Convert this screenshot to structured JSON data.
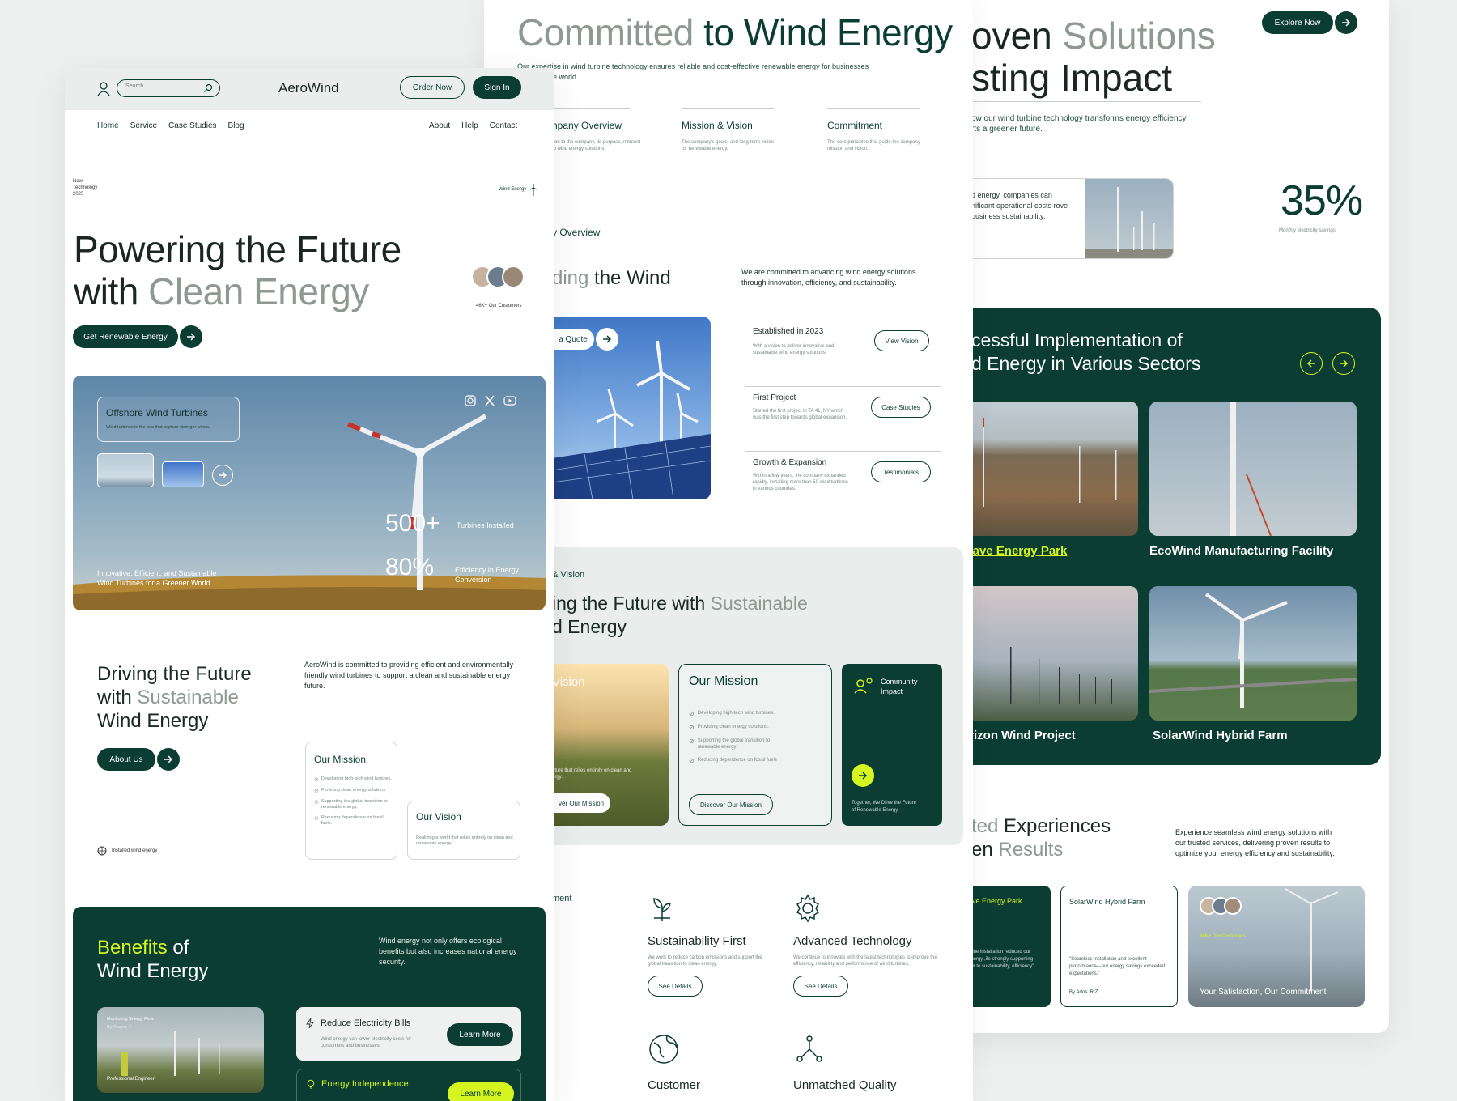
{
  "colors": {
    "primary": "#0b3d33",
    "accent": "#d4f51f",
    "bg": "#eef0ef"
  },
  "left": {
    "nav": {
      "search_placeholder": "Search",
      "logo": "AeroWind",
      "order": "Order Now",
      "signin": "Sign In",
      "links": [
        "Home",
        "Service",
        "Case Studies",
        "Blog"
      ],
      "links_right": [
        "About",
        "Help",
        "Contact"
      ]
    },
    "hero": {
      "tag1": "New",
      "tag2": "Technology",
      "tag3": "2025",
      "wind_tag": "Wind Energy",
      "title1": "Powering the Future",
      "title2a": "with ",
      "title2b": "Clean Energy",
      "customers": "46K+ Our Customers",
      "cta": "Get Renewable Energy"
    },
    "banner": {
      "card_title": "Offshore Wind Turbines",
      "card_sub": "Wind turbines in the sea that capture stronger winds.",
      "stat1": "500+",
      "stat1_label": "Turbines Installed",
      "stat2": "80%",
      "stat2_label1": "Efficiency in Energy",
      "stat2_label2": "Conversion",
      "caption1": "Innovative, Efficient, and Sustainable",
      "caption2": "Wind Turbines for a Greener World"
    },
    "about": {
      "t1": "Driving the Future",
      "t2a": "with ",
      "t2b": "Sustainable",
      "t3": "Wind Energy",
      "desc": "AeroWind is committed to providing efficient and environmentally friendly wind turbines to support a clean and sustainable energy future.",
      "btn": "About Us",
      "installed": "Installed wind energy",
      "mission_title": "Our Mission",
      "mission_items": [
        "Developing high-tech wind turbines.",
        "Providing clean energy solutions.",
        "Supporting the global transition to renewable energy.",
        "Reducing dependence on fossil fuels."
      ],
      "vision_title": "Our Vision",
      "vision_text": "Realizing a world that relies entirely on clean and renewable energy."
    },
    "benefits": {
      "t1a": "Benefits",
      "t1b": " of",
      "t2": "Wind Energy",
      "desc": "Wind energy not only offers ecological benefits but also increases national energy security.",
      "photo_title": "Monitoring Energy Flow",
      "photo_by": "By Dianne T.",
      "photo_tag": "Professional Engineer",
      "b1": "Reduce Electricity Bills",
      "b1_desc": "Wind energy can lower electricity costs for consumers and businesses.",
      "b1_btn": "Learn More",
      "b2": "Energy Independence",
      "b2_btn": "Learn More"
    }
  },
  "middle": {
    "title_a": "Committed",
    "title_b": " to Wind Energy",
    "intro": "Our expertise in wind turbine technology ensures reliable and cost-effective renewable energy for businesses",
    "intro2": "e world.",
    "cols": [
      {
        "t": "npany Overview",
        "d": "tion to the company, its purpose, mitment to wind energy solutions."
      },
      {
        "t": "Mission & Vision",
        "d": "The company's goals, and long-term vision for renewable energy."
      },
      {
        "t": "Commitment",
        "d": "The core principles that guide the company mission and vision."
      }
    ],
    "overview_label": "y Overview",
    "lead_a": "ding",
    "lead_b": " the Wind",
    "lead_desc": "We are committed to advancing wind energy solutions through innovation, efficiency, and sustainability.",
    "quote": "a Quote",
    "timeline": [
      {
        "t": "Established in 2023",
        "d": "With a vision to deliver innovative and sustainable wind energy solutions.",
        "b": "View Vision"
      },
      {
        "t": "First Project",
        "d": "Started the first project in TA 41, NY which was the first step towards global expansion.",
        "b": "Case Studies"
      },
      {
        "t": "Growth & Expansion",
        "d": "Within a few years, the company expanded rapidly, installing more than 50 wind turbines in various countries.",
        "b": "Testimonials"
      }
    ],
    "mv_label": "& Vision",
    "mv_t1a": "ing the Future with ",
    "mv_t1b": "Sustainable",
    "mv_t2": "d Energy",
    "vision_card": "Vision",
    "vision_caption": "uture that relies entirely on clean and ergy.",
    "vision_btn": "ver Our Mission",
    "mission_title": "Our Mission",
    "mission_items": [
      "Developing high-tech wind turbines.",
      "Providing clean energy solutions.",
      "Supporting the global transition to renewable energy",
      "Reducing dependence on fossil fuels"
    ],
    "mission_btn": "Discover Our Mission",
    "community_t1": "Community",
    "community_t2": "Impact",
    "community_foot1": "Together, We Drive the Future",
    "community_foot2": "of Renewable Energy",
    "commit_label": "ment",
    "features": [
      {
        "t": "Sustainability First",
        "d": "We work to reduce carbon emissions and support the global transition to clean energy.",
        "b": "See Details"
      },
      {
        "t": "Advanced Technology",
        "d": "We continue to innovate with the latest technologies to improve the efficiency, reliability and performance of wind turbines.",
        "b": "See Details"
      },
      {
        "t": "Customer",
        "d": ""
      },
      {
        "t": "Unmatched Quality",
        "d": ""
      }
    ]
  },
  "right": {
    "explore": "Explore Now",
    "title_a": "oven ",
    "title_b": "Solutions",
    "title_c": "sting Impact",
    "intro": "ow our wind turbine technology transforms energy efficiency rts a greener future.",
    "card_text": "d energy, companies can nificant operational costs rove business sustainability.",
    "stat": "35%",
    "stat_label": "Monthly electricity savings",
    "impl_t1": "cessful Implementation of",
    "impl_t2": "d Energy in Various Sectors",
    "projects": [
      "Wave Energy Park",
      "EcoWind Manufacturing Facility",
      "orizon Wind Project",
      "SolarWind Hybrid Farm"
    ],
    "exp_t1a": "ted ",
    "exp_t1b": "Experiences",
    "exp_t2a": "en ",
    "exp_t2b": "Results",
    "exp_desc": "Experience seamless wind energy solutions with our trusted services, delivering proven results to optimize your energy efficiency and sustainability.",
    "t1_title": "ave Energy Park",
    "t1_text": "rbine installation reduced our energy ,ile strongly supporting our to sustainability, efficiency\"",
    "t2_title": "SolarWind Hybrid Farm",
    "t2_text": "\"Seamless installation and excellent performance—our energy savings exceeded expectations.\"",
    "t2_by": "By Artos .R.Z.",
    "t3_customers": "46K+ Our Customers",
    "t3_caption": "Your Satisfaction, Our Commitment"
  }
}
